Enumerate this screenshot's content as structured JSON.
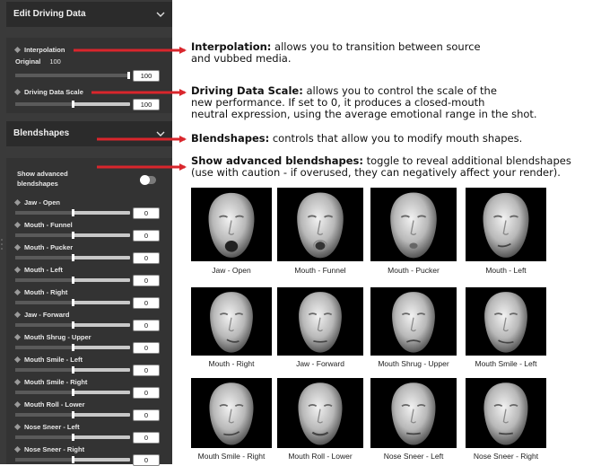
{
  "panel": {
    "edit_title": "Edit Driving Data",
    "interpolation_label": "Interpolation",
    "original_label": "Original",
    "original_value": "100",
    "interpolation_value": "100",
    "interpolation_level": 1.0,
    "driving_scale_label": "Driving Data Scale",
    "driving_scale_value": "100",
    "driving_scale_level": 0.5,
    "blendshapes_title": "Blendshapes",
    "show_advanced_label": "Show advanced blendshapes",
    "show_advanced_on": false,
    "blendshapes": [
      {
        "label": "Jaw - Open",
        "value": "0"
      },
      {
        "label": "Mouth - Funnel",
        "value": "0"
      },
      {
        "label": "Mouth - Pucker",
        "value": "0"
      },
      {
        "label": "Mouth - Left",
        "value": "0"
      },
      {
        "label": "Mouth - Right",
        "value": "0"
      },
      {
        "label": "Jaw - Forward",
        "value": "0"
      },
      {
        "label": "Mouth Shrug - Upper",
        "value": "0"
      },
      {
        "label": "Mouth Smile - Left",
        "value": "0"
      },
      {
        "label": "Mouth Smile - Right",
        "value": "0"
      },
      {
        "label": "Mouth Roll - Lower",
        "value": "0"
      },
      {
        "label": "Nose Sneer - Left",
        "value": "0"
      },
      {
        "label": "Nose Sneer - Right",
        "value": "0"
      }
    ]
  },
  "descriptions": {
    "interpolation": {
      "term": "Interpolation:",
      "text1": " allows you to transition between source",
      "text2": "and vubbed media."
    },
    "driving_scale": {
      "term": "Driving Data Scale:",
      "text1": " allows you to control the scale of the",
      "text2": "new performance. If set to 0, it produces a closed-mouth",
      "text3": "neutral expression, using the average emotional range in the shot."
    },
    "blendshapes": {
      "term": "Blendshapes:",
      "text1": " controls that allow you to modify mouth shapes."
    },
    "show_advanced": {
      "term": "Show advanced blendshapes:",
      "text1": " toggle to reveal additional blendshapes",
      "text2": "(use with caution - if overused, they can negatively affect your render)."
    }
  },
  "faces": [
    {
      "caption": "Jaw - Open"
    },
    {
      "caption": "Mouth - Funnel"
    },
    {
      "caption": "Mouth - Pucker"
    },
    {
      "caption": "Mouth - Left"
    },
    {
      "caption": "Mouth - Right"
    },
    {
      "caption": "Jaw - Forward"
    },
    {
      "caption": "Mouth Shrug - Upper"
    },
    {
      "caption": "Mouth Smile - Left"
    },
    {
      "caption": "Mouth Smile - Right"
    },
    {
      "caption": "Mouth Roll - Lower"
    },
    {
      "caption": "Nose Sneer - Left"
    },
    {
      "caption": "Nose Sneer - Right"
    }
  ],
  "colors": {
    "arrow": "#d9262c",
    "panel": "#3a3a3a",
    "header": "#2b2b2b"
  }
}
